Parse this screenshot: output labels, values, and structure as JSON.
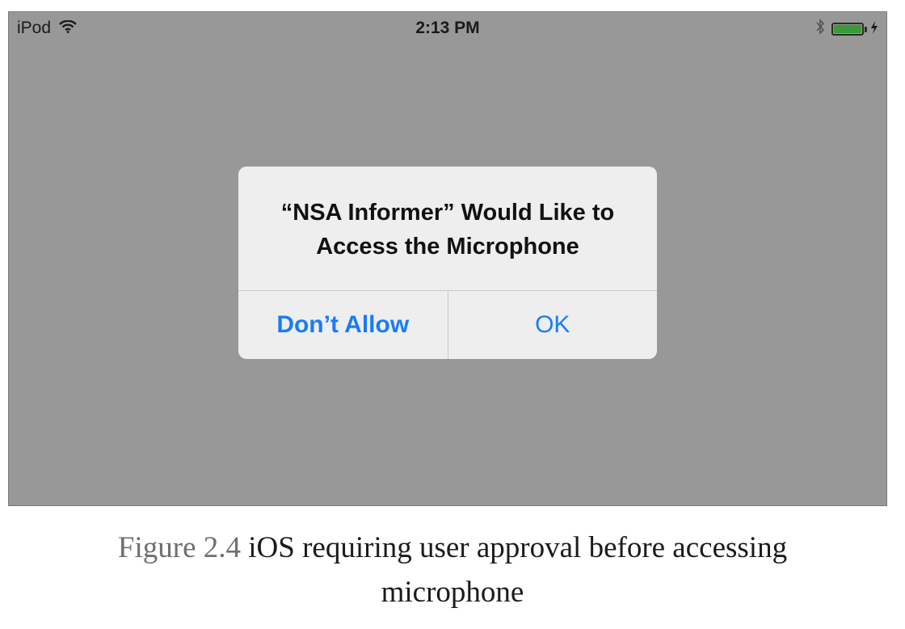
{
  "status_bar": {
    "device": "iPod",
    "time": "2:13 PM",
    "icons": [
      "wifi-icon",
      "bluetooth-icon",
      "battery-icon",
      "charging-icon"
    ]
  },
  "alert": {
    "title_line1": "“NSA Informer” Would Like to",
    "title_line2": "Access the Microphone",
    "buttons": {
      "dont_allow": "Don’t Allow",
      "ok": "OK"
    }
  },
  "caption": {
    "label": "Figure 2.4",
    "text_line1": "iOS requiring user approval before accessing",
    "text_line2": "microphone"
  },
  "colors": {
    "screen_background": "#989898",
    "alert_background": "#eeeeee",
    "button_text": "#1a7cf5",
    "battery": "#3a9a33"
  }
}
